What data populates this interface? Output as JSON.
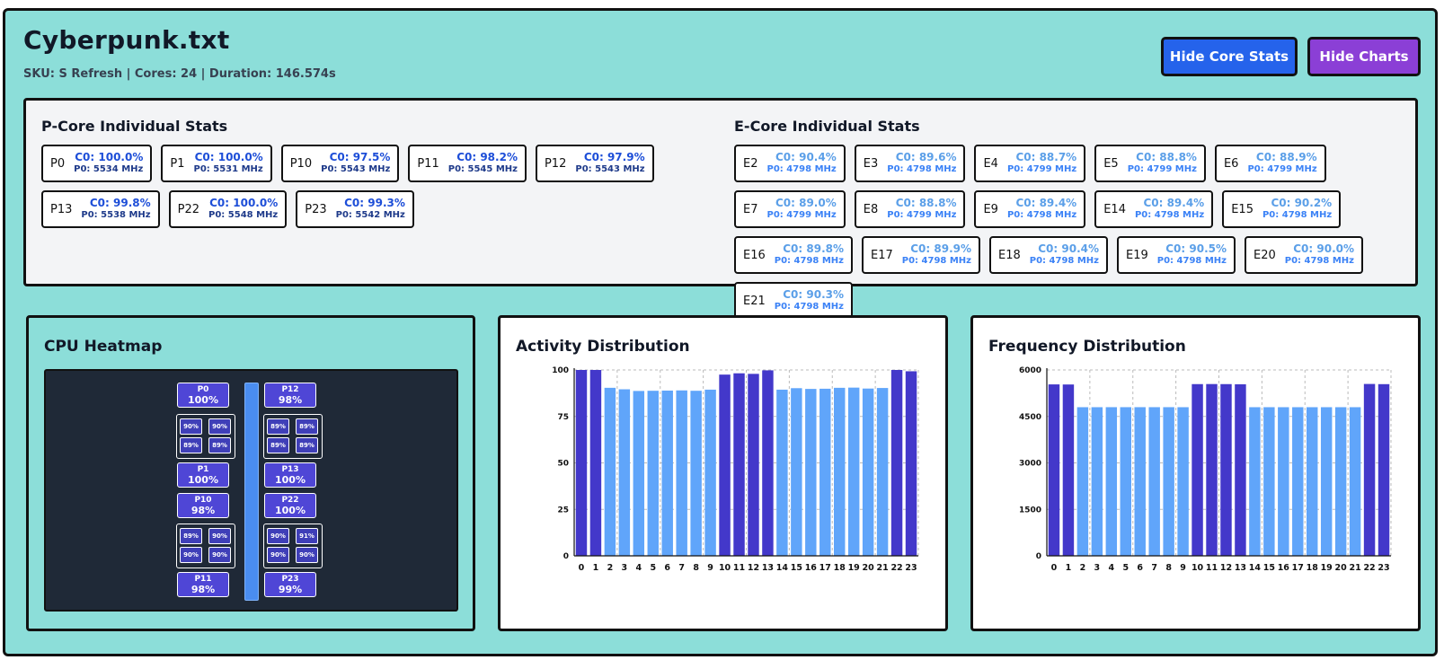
{
  "header": {
    "title": "Cyberpunk.txt",
    "subtitle": "SKU: S Refresh | Cores: 24 | Duration: 146.574s",
    "buttons": {
      "hide_core_stats": "Hide Core Stats",
      "hide_charts": "Hide Charts"
    }
  },
  "colors": {
    "background": "#8cded9",
    "pcore": "#4338ca",
    "ecore": "#60a5fa",
    "button_blue": "#2563eb",
    "button_purple": "#8b3fd6"
  },
  "pcore_stats": {
    "title": "P-Core Individual Stats",
    "cores": [
      {
        "name": "P0",
        "c0": "C0: 100.0%",
        "p0": "P0: 5534 MHz"
      },
      {
        "name": "P1",
        "c0": "C0: 100.0%",
        "p0": "P0: 5531 MHz"
      },
      {
        "name": "P10",
        "c0": "C0: 97.5%",
        "p0": "P0: 5543 MHz"
      },
      {
        "name": "P11",
        "c0": "C0: 98.2%",
        "p0": "P0: 5545 MHz"
      },
      {
        "name": "P12",
        "c0": "C0: 97.9%",
        "p0": "P0: 5543 MHz"
      },
      {
        "name": "P13",
        "c0": "C0: 99.8%",
        "p0": "P0: 5538 MHz"
      },
      {
        "name": "P22",
        "c0": "C0: 100.0%",
        "p0": "P0: 5548 MHz"
      },
      {
        "name": "P23",
        "c0": "C0: 99.3%",
        "p0": "P0: 5542 MHz"
      }
    ]
  },
  "ecore_stats": {
    "title": "E-Core Individual Stats",
    "cores": [
      {
        "name": "E2",
        "c0": "C0: 90.4%",
        "p0": "P0: 4798 MHz"
      },
      {
        "name": "E3",
        "c0": "C0: 89.6%",
        "p0": "P0: 4798 MHz"
      },
      {
        "name": "E4",
        "c0": "C0: 88.7%",
        "p0": "P0: 4799 MHz"
      },
      {
        "name": "E5",
        "c0": "C0: 88.8%",
        "p0": "P0: 4799 MHz"
      },
      {
        "name": "E6",
        "c0": "C0: 88.9%",
        "p0": "P0: 4799 MHz"
      },
      {
        "name": "E7",
        "c0": "C0: 89.0%",
        "p0": "P0: 4799 MHz"
      },
      {
        "name": "E8",
        "c0": "C0: 88.8%",
        "p0": "P0: 4799 MHz"
      },
      {
        "name": "E9",
        "c0": "C0: 89.4%",
        "p0": "P0: 4798 MHz"
      },
      {
        "name": "E14",
        "c0": "C0: 89.4%",
        "p0": "P0: 4798 MHz"
      },
      {
        "name": "E15",
        "c0": "C0: 90.2%",
        "p0": "P0: 4798 MHz"
      },
      {
        "name": "E16",
        "c0": "C0: 89.8%",
        "p0": "P0: 4798 MHz"
      },
      {
        "name": "E17",
        "c0": "C0: 89.9%",
        "p0": "P0: 4798 MHz"
      },
      {
        "name": "E18",
        "c0": "C0: 90.4%",
        "p0": "P0: 4798 MHz"
      },
      {
        "name": "E19",
        "c0": "C0: 90.5%",
        "p0": "P0: 4798 MHz"
      },
      {
        "name": "E20",
        "c0": "C0: 90.0%",
        "p0": "P0: 4798 MHz"
      },
      {
        "name": "E21",
        "c0": "C0: 90.3%",
        "p0": "P0: 4798 MHz"
      }
    ]
  },
  "heatmap": {
    "title": "CPU Heatmap",
    "left_column": [
      {
        "kind": "pcore",
        "name": "P0",
        "value": "100%"
      },
      {
        "kind": "cluster",
        "values": [
          "90%",
          "90%",
          "89%",
          "89%"
        ]
      },
      {
        "kind": "pcore",
        "name": "P1",
        "value": "100%"
      },
      {
        "kind": "pcore",
        "name": "P10",
        "value": "98%"
      },
      {
        "kind": "cluster",
        "values": [
          "89%",
          "90%",
          "90%",
          "90%"
        ]
      },
      {
        "kind": "pcore",
        "name": "P11",
        "value": "98%"
      }
    ],
    "right_column": [
      {
        "kind": "pcore",
        "name": "P12",
        "value": "98%"
      },
      {
        "kind": "cluster",
        "values": [
          "89%",
          "89%",
          "89%",
          "89%"
        ]
      },
      {
        "kind": "pcore",
        "name": "P13",
        "value": "100%"
      },
      {
        "kind": "pcore",
        "name": "P22",
        "value": "100%"
      },
      {
        "kind": "cluster",
        "values": [
          "90%",
          "91%",
          "90%",
          "90%"
        ]
      },
      {
        "kind": "pcore",
        "name": "P23",
        "value": "99%"
      }
    ]
  },
  "chart_data": [
    {
      "type": "bar",
      "title": "Activity Distribution",
      "categories": [
        "0",
        "1",
        "2",
        "3",
        "4",
        "5",
        "6",
        "7",
        "8",
        "9",
        "10",
        "11",
        "12",
        "13",
        "14",
        "15",
        "16",
        "17",
        "18",
        "19",
        "20",
        "21",
        "22",
        "23"
      ],
      "values": [
        100,
        100,
        90.4,
        89.6,
        88.7,
        88.8,
        88.9,
        89.0,
        88.8,
        89.4,
        97.5,
        98.2,
        97.9,
        99.8,
        89.4,
        90.2,
        89.8,
        89.9,
        90.4,
        90.5,
        90.0,
        90.3,
        100,
        99.3
      ],
      "core_types": [
        "P",
        "P",
        "E",
        "E",
        "E",
        "E",
        "E",
        "E",
        "E",
        "E",
        "P",
        "P",
        "P",
        "P",
        "E",
        "E",
        "E",
        "E",
        "E",
        "E",
        "E",
        "E",
        "P",
        "P"
      ],
      "yticks": [
        "0",
        "25",
        "50",
        "75",
        "100"
      ],
      "ylim": [
        0,
        100
      ],
      "grid": true
    },
    {
      "type": "bar",
      "title": "Frequency Distribution",
      "categories": [
        "0",
        "1",
        "2",
        "3",
        "4",
        "5",
        "6",
        "7",
        "8",
        "9",
        "10",
        "11",
        "12",
        "13",
        "14",
        "15",
        "16",
        "17",
        "18",
        "19",
        "20",
        "21",
        "22",
        "23"
      ],
      "values": [
        5534,
        5531,
        4798,
        4798,
        4799,
        4799,
        4799,
        4799,
        4799,
        4798,
        5543,
        5545,
        5543,
        5538,
        4798,
        4798,
        4798,
        4798,
        4798,
        4798,
        4798,
        4798,
        5548,
        5542
      ],
      "core_types": [
        "P",
        "P",
        "E",
        "E",
        "E",
        "E",
        "E",
        "E",
        "E",
        "E",
        "P",
        "P",
        "P",
        "P",
        "E",
        "E",
        "E",
        "E",
        "E",
        "E",
        "E",
        "E",
        "P",
        "P"
      ],
      "yticks": [
        "0",
        "1500",
        "3000",
        "4500",
        "6000"
      ],
      "ylim": [
        0,
        6000
      ],
      "grid": true
    }
  ]
}
